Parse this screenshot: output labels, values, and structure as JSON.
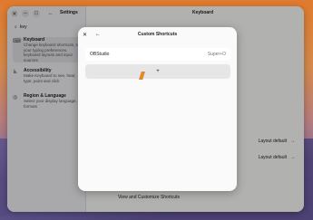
{
  "settings": {
    "side_title": "Settings",
    "main_title": "Keyboard",
    "search_value": "key",
    "items": [
      {
        "label": "Keyboard",
        "desc": "Change keyboard shortcuts, set your typing preferences, keyboard layouts and input sources"
      },
      {
        "label": "Accessibility",
        "desc": "Make Keyboard to see, hear, type, point and click"
      },
      {
        "label": "Region & Language",
        "desc": "Select your display language, formats"
      }
    ],
    "rows": [
      {
        "label": "Layout default"
      },
      {
        "label": "Layout default"
      }
    ],
    "bottom_label": "View and Customize Shortcuts"
  },
  "dialog": {
    "title": "Custom Shortcuts",
    "shortcut_name": "OBStudio",
    "shortcut_accel": "Super+O",
    "add_label": "+"
  }
}
